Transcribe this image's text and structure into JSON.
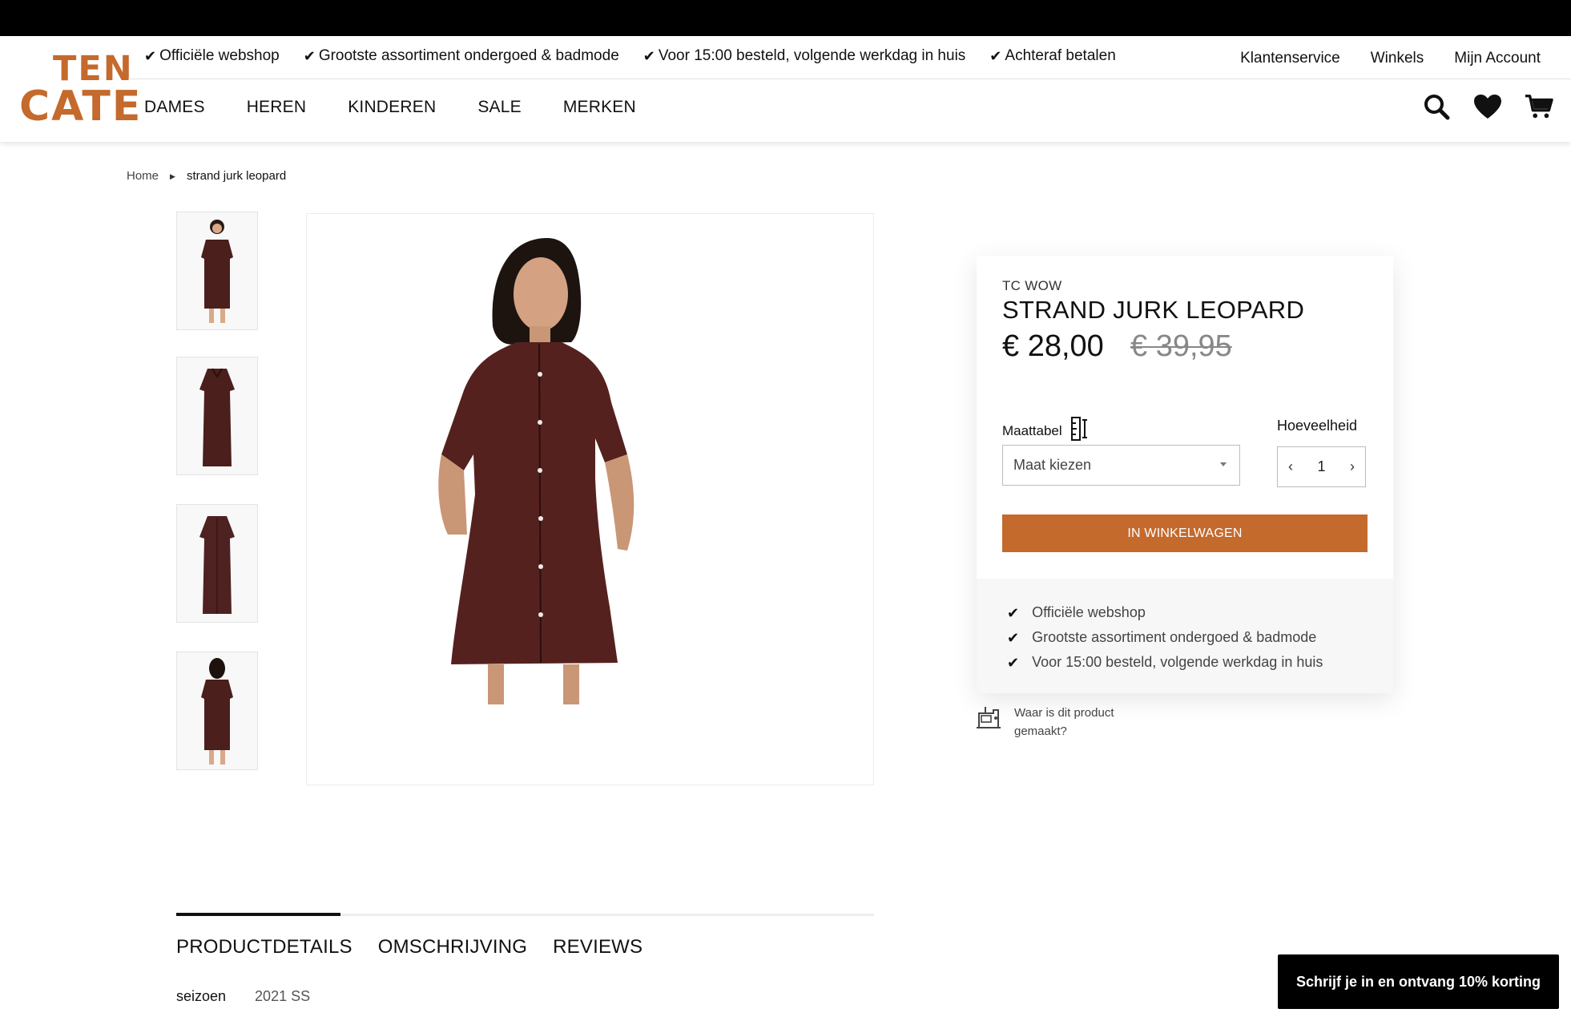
{
  "logo": {
    "line1": "TEN",
    "line2": "CATE",
    "color": "#c46a2c"
  },
  "usps_top": [
    {
      "label": "Officiële webshop"
    },
    {
      "label": "Grootste assortiment ondergoed & badmode"
    },
    {
      "label": "Voor 15:00 besteld, volgende werkdag in huis"
    },
    {
      "label": "Achteraf betalen"
    }
  ],
  "service_links": [
    {
      "label": "Klantenservice"
    },
    {
      "label": "Winkels"
    },
    {
      "label": "Mijn Account"
    }
  ],
  "nav": [
    {
      "label": "DAMES"
    },
    {
      "label": "HEREN"
    },
    {
      "label": "KINDEREN"
    },
    {
      "label": "SALE"
    },
    {
      "label": "MERKEN"
    }
  ],
  "header_icons": [
    "search-icon",
    "heart-icon",
    "cart-icon"
  ],
  "breadcrumb": {
    "home": "Home",
    "current": "strand jurk leopard"
  },
  "product": {
    "brand": "TC WOW",
    "title": "STRAND JURK LEOPARD",
    "price_now": "€ 28,00",
    "price_old": "€ 39,95",
    "size_label": "Maattabel",
    "size_placeholder": "Maat kiezen",
    "qty_label": "Hoeveelheid",
    "qty_value": "1",
    "add_to_cart": "IN WINKELWAGEN",
    "accent_color": "#c46a2c"
  },
  "usps_box": [
    {
      "label": "Officiële webshop"
    },
    {
      "label": "Grootste assortiment ondergoed & badmode"
    },
    {
      "label": "Voor 15:00 besteld, volgende werkdag in huis"
    }
  ],
  "made_in": {
    "label": "Waar is dit product gemaakt?"
  },
  "tabs": [
    {
      "label": "PRODUCTDETAILS",
      "active": true
    },
    {
      "label": "OMSCHRIJVING",
      "active": false
    },
    {
      "label": "REVIEWS",
      "active": false
    }
  ],
  "specs": [
    {
      "key": "seizoen",
      "value": "2021 SS"
    }
  ],
  "newsletter": {
    "label": "Schrijf je in en ontvang 10% korting"
  }
}
